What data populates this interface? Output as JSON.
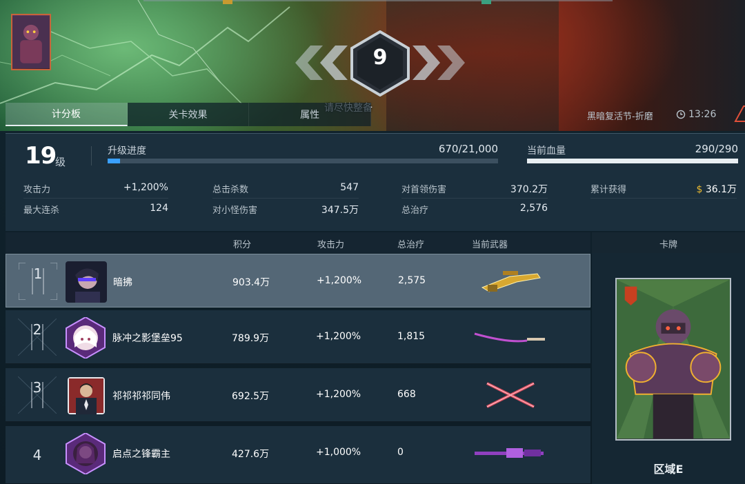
{
  "countdown": {
    "number": "9",
    "hint": "请尽快整备"
  },
  "tabs": [
    {
      "label": "计分板",
      "active": true
    },
    {
      "label": "关卡效果",
      "active": false
    },
    {
      "label": "属性",
      "active": false
    }
  ],
  "event": {
    "name": "黑暗复活节-折磨",
    "timer": "13:26"
  },
  "player": {
    "level": "19",
    "level_unit": "级",
    "upgrade_label": "升级进度",
    "upgrade_value": "670/21,000",
    "upgrade_fraction": 0.0319,
    "hp_label": "当前血量",
    "hp_value": "290/290",
    "hp_fraction": 1.0
  },
  "stats": [
    {
      "key": "攻击力",
      "value": "+1,200%"
    },
    {
      "key": "总击杀数",
      "value": "547"
    },
    {
      "key": "对首领伤害",
      "value": "370.2万"
    },
    {
      "key": "累计获得",
      "value": "$ 36.1万"
    },
    {
      "key": "最大连杀",
      "value": "124"
    },
    {
      "key": "对小怪伤害",
      "value": "347.5万"
    },
    {
      "key": "总治疗",
      "value": "2,576"
    }
  ],
  "scoreboard": {
    "headers": {
      "score": "积分",
      "attack": "攻击力",
      "heal": "总治疗",
      "weapon": "当前武器"
    },
    "rows": [
      {
        "rank": "1",
        "name": "暗拂",
        "score": "903.4万",
        "attack": "+1,200%",
        "heal": "2,575",
        "weapon_icon": "gold-sniper-rifle-icon"
      },
      {
        "rank": "2",
        "name": "脉冲之影堡垒95",
        "score": "789.9万",
        "attack": "+1,200%",
        "heal": "1,815",
        "weapon_icon": "katana-icon"
      },
      {
        "rank": "3",
        "name": "祁祁祁祁同伟",
        "score": "692.5万",
        "attack": "+1,200%",
        "heal": "668",
        "weapon_icon": "crossed-blades-icon"
      },
      {
        "rank": "4",
        "name": "启点之锋霸主",
        "score": "427.6万",
        "attack": "+1,000%",
        "heal": "0",
        "weapon_icon": "purple-rifle-icon"
      }
    ]
  },
  "card_panel": {
    "header": "卡牌",
    "zone": "区域E"
  },
  "colors": {
    "accent_blue": "#3aa0ff",
    "gold": "#e8b830",
    "panel": "#1c303e"
  }
}
